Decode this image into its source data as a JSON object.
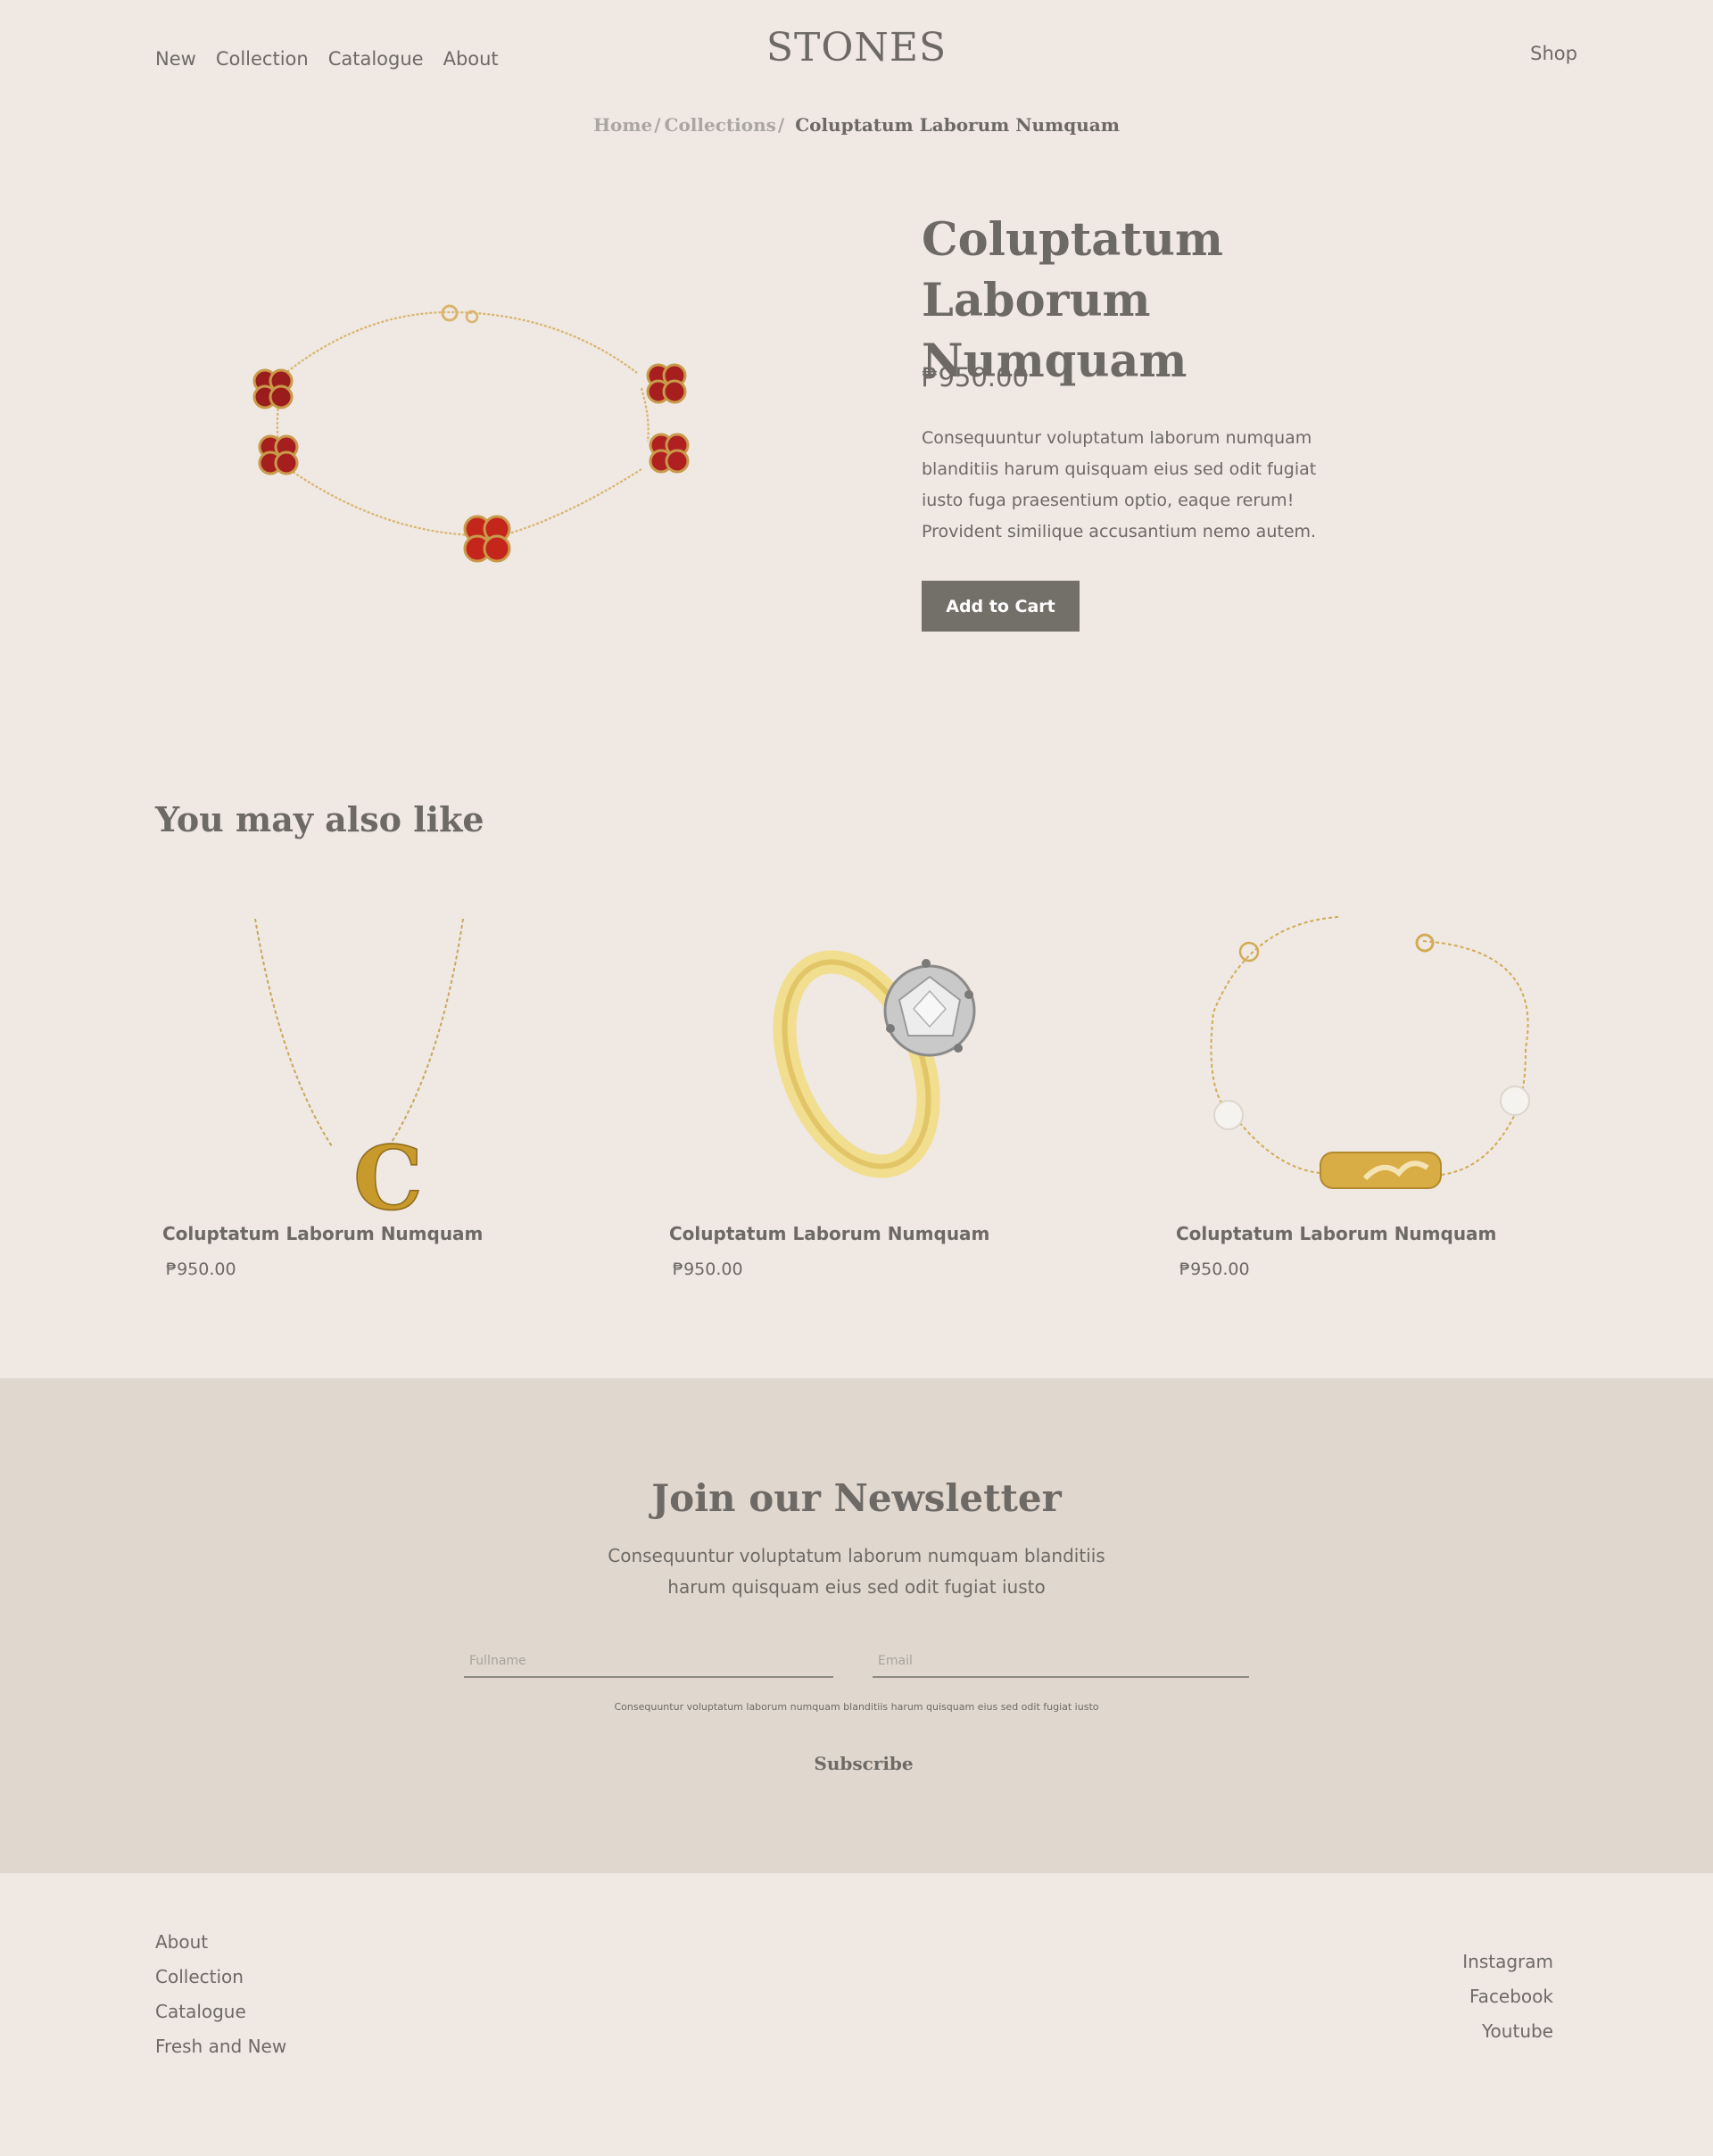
{
  "header": {
    "nav": [
      "New",
      "Collection",
      "Catalogue",
      "About"
    ],
    "logo": "STONES",
    "shop": "Shop"
  },
  "breadcrumb": {
    "home": "Home",
    "collections": "Collections",
    "current": "Coluptatum Laborum Numquam"
  },
  "product": {
    "title": "Coluptatum Laborum Numquam",
    "price": "₱950.00",
    "description": "Consequuntur voluptatum laborum numquam blanditiis harum quisquam eius sed odit fugiat iusto fuga praesentium optio, eaque rerum! Provident similique accusantium nemo autem.",
    "add_to_cart": "Add to Cart"
  },
  "also_like": {
    "title": "You may also like",
    "items": [
      {
        "name": "Coluptatum Laborum Numquam",
        "price": "₱950.00"
      },
      {
        "name": "Coluptatum Laborum Numquam",
        "price": "₱950.00"
      },
      {
        "name": "Coluptatum Laborum Numquam",
        "price": "₱950.00"
      }
    ]
  },
  "newsletter": {
    "title": "Join our Newsletter",
    "description": "Consequuntur voluptatum laborum numquam blanditiis harum quisquam eius sed odit fugiat iusto",
    "fullname_placeholder": "Fullname",
    "email_placeholder": "Email",
    "small_text": "Consequuntur voluptatum laborum numquam blanditiis harum quisquam eius sed odit fugiat iusto",
    "subscribe": "Subscribe"
  },
  "footer": {
    "left": [
      "About",
      "Collection",
      "Catalogue",
      "Fresh and New"
    ],
    "right": [
      "Instagram",
      "Facebook",
      "Youtube"
    ]
  }
}
